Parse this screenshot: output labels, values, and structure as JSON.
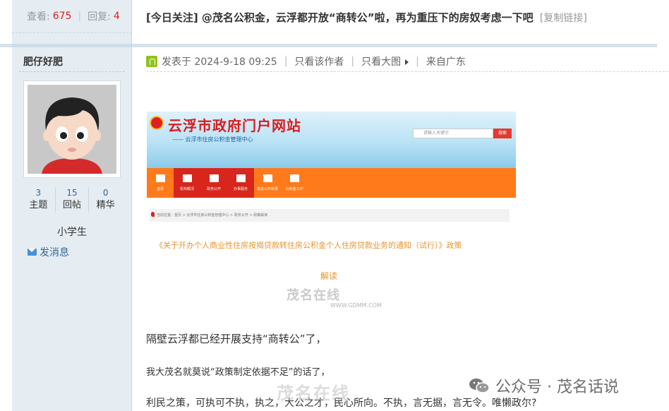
{
  "thread": {
    "views_label": "查看:",
    "views": "675",
    "replies_label": "回复:",
    "replies": "4",
    "title": "[今日关注] @茂名公积金，云浮都开放“商转公”啦，再为重压下的房奴考虑一下吧",
    "copy_link": "[复制链接]"
  },
  "author": {
    "name": "肥仔好肥",
    "stats": [
      {
        "value": "3",
        "label": "主题"
      },
      {
        "value": "15",
        "label": "回帖"
      },
      {
        "value": "0",
        "label": "精华"
      }
    ],
    "rank": "小学生",
    "pm_label": "发消息"
  },
  "post_meta": {
    "posted_at": "发表于 2024-9-18 09:25",
    "only_author": "只看该作者",
    "only_images": "只看大图",
    "from": "来自广东"
  },
  "embed": {
    "site_title": "云浮市政府门户网站",
    "site_subtitle": "—— 云浮市住房公积金管理中心",
    "search_placeholder": "请输入关键字",
    "search_button": "搜索",
    "nav": [
      "首页",
      "机构概况",
      "政务公开",
      "办事服务",
      "信息公开目录",
      "公积金工作"
    ],
    "breadcrumb": "当前位置：首页 > 云浮市住房公积金管理中心 > 政务公开 > 政策解读",
    "policy_title": "《关于开办个人商业性住房按揭贷款转住房公积金个人住房贷款业务的通知（试行）》政策",
    "jiedu": "解读",
    "watermark_text": "茂名在线",
    "watermark_url": "WWW.GDMM.COM"
  },
  "body": {
    "p1": "隔壁云浮都已经开展支持“商转公”了，",
    "p2": "我大茂名就莫说“政策制定依据不足”的话了，",
    "p3": "利民之策，可执可不执，执之，大公之才，民心所向。不执，言无据，言无令。唯懒政尔?"
  },
  "watermarks": {
    "wechat": "公众号 · 茂名话说",
    "site": "茂名在线"
  },
  "colors": {
    "sidebar_bg": "#e5edf2",
    "accent_red": "#e31e1e",
    "link_blue": "#336699",
    "nav_orange": "#ff7a1a"
  }
}
